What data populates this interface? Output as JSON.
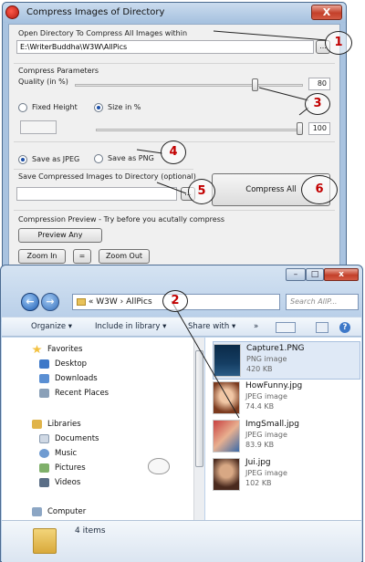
{
  "app_window": {
    "title": "Compress Images of Directory",
    "close_label": "X",
    "open_dir_label": "Open Directory To Compress All Images within",
    "dir_path": "E:\\WriterBuddha\\W3W\\AllPics",
    "browse_label": "...",
    "params_label": "Compress Parameters",
    "quality_label": "Quality (in %)",
    "quality_value": "80",
    "quality_fraction": 0.8,
    "fixed_height_label": "Fixed Height",
    "size_in_percent_label": "Size in %",
    "size_value": "100",
    "size_fraction": 1.0,
    "save_jpeg_label": "Save as JPEG",
    "save_png_label": "Save as PNG",
    "save_dir_label": "Save Compressed Images to Directory (optional)",
    "save_browse_label": "...",
    "compress_all_label": "Compress All",
    "preview_section_label": "Compression Preview - Try before you acutally compress",
    "preview_any_label": "Preview Any",
    "zoom_in_label": "Zoom In",
    "equals_label": "=",
    "zoom_out_label": "Zoom Out"
  },
  "callouts": [
    "1",
    "2",
    "3",
    "4",
    "5",
    "6"
  ],
  "explorer": {
    "min_label": "–",
    "max_label": "□",
    "close_label": "x",
    "back_icon": "←",
    "forward_icon": "→",
    "breadcrumb_prefix": "«",
    "breadcrumb_1": "W3W",
    "breadcrumb_sep": "›",
    "breadcrumb_2": "AllPics",
    "search_placeholder": "Search AllP...",
    "toolbar": {
      "organize": "Organize ▾",
      "include": "Include in library ▾",
      "share": "Share with ▾",
      "more": "»",
      "help": "?"
    },
    "nav": {
      "favorites": "Favorites",
      "desktop": "Desktop",
      "downloads": "Downloads",
      "recent": "Recent Places",
      "libraries": "Libraries",
      "documents": "Documents",
      "music": "Music",
      "pictures": "Pictures",
      "videos": "Videos",
      "computer": "Computer"
    },
    "files": [
      {
        "name": "Capture1.PNG",
        "type": "PNG image",
        "size": "420 KB"
      },
      {
        "name": "HowFunny.jpg",
        "type": "JPEG image",
        "size": "74.4 KB"
      },
      {
        "name": "ImgSmall.jpg",
        "type": "JPEG image",
        "size": "83.9 KB"
      },
      {
        "name": "Jui.jpg",
        "type": "JPEG image",
        "size": "102 KB"
      }
    ],
    "status": "4 items"
  },
  "colors": {
    "accent": "#1e5fb4",
    "callout_text": "#c20000"
  }
}
